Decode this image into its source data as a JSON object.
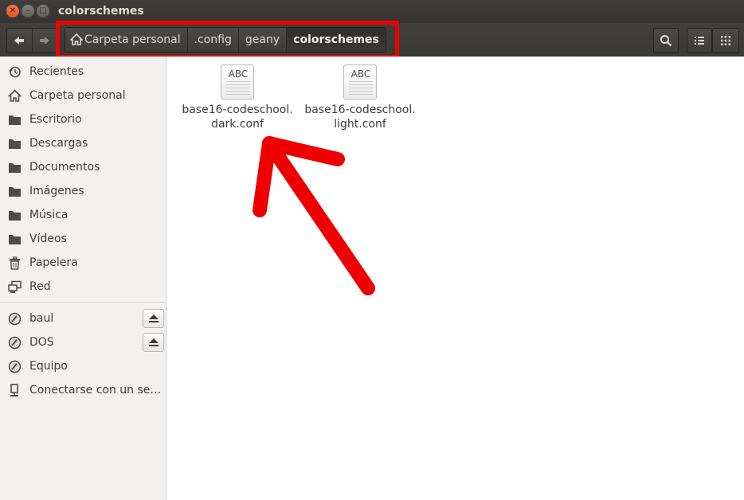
{
  "window": {
    "title": "colorschemes"
  },
  "breadcrumbs": [
    {
      "label": "Carpeta personal",
      "icon": "home-icon"
    },
    {
      "label": ".config"
    },
    {
      "label": "geany"
    },
    {
      "label": "colorschemes",
      "current": true
    }
  ],
  "sidebar": {
    "places": [
      {
        "label": "Recientes",
        "icon": "recent-icon"
      },
      {
        "label": "Carpeta personal",
        "icon": "home-icon"
      },
      {
        "label": "Escritorio",
        "icon": "folder-icon"
      },
      {
        "label": "Descargas",
        "icon": "folder-icon"
      },
      {
        "label": "Documentos",
        "icon": "folder-icon"
      },
      {
        "label": "Imágenes",
        "icon": "folder-icon"
      },
      {
        "label": "Música",
        "icon": "folder-icon"
      },
      {
        "label": "Vídeos",
        "icon": "folder-icon"
      },
      {
        "label": "Papelera",
        "icon": "trash-icon"
      },
      {
        "label": "Red",
        "icon": "network-icon"
      }
    ],
    "devices": [
      {
        "label": "baul",
        "icon": "drive-icon",
        "ejectable": true
      },
      {
        "label": "DOS",
        "icon": "drive-icon",
        "ejectable": true
      },
      {
        "label": "Equipo",
        "icon": "drive-icon",
        "ejectable": false
      },
      {
        "label": "Conectarse con un servidor",
        "icon": "server-icon",
        "ejectable": false
      }
    ]
  },
  "files": [
    {
      "icon_text": "ABC",
      "name_line1": "base16-codeschool.",
      "name_line2": "dark.conf"
    },
    {
      "icon_text": "ABC",
      "name_line1": "base16-codeschool.",
      "name_line2": "light.conf"
    }
  ],
  "colors": {
    "annotation": "#ee0000",
    "titlebar": "#3c3b37",
    "sidebar": "#f2f1f0"
  }
}
